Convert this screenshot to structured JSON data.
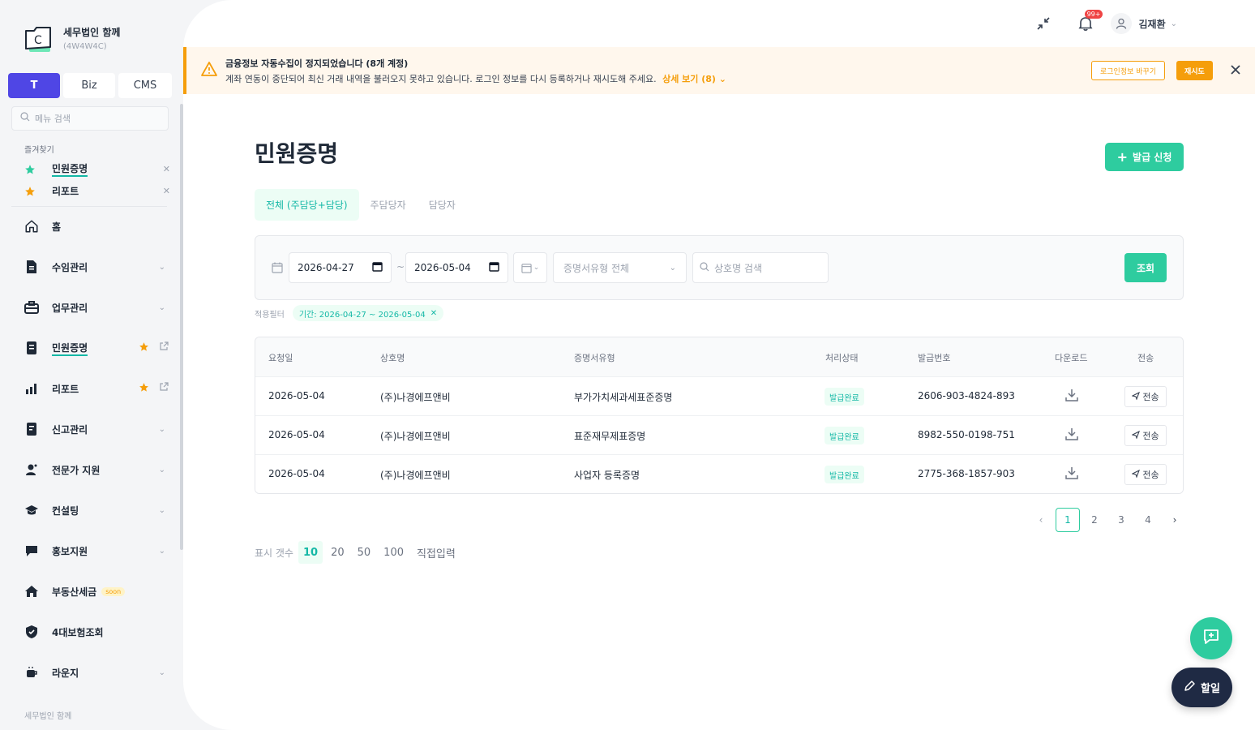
{
  "brand": {
    "name": "세무법인 함께",
    "code": "(4W4W4C)"
  },
  "mode_tabs": [
    {
      "label": "T"
    },
    {
      "label": "Biz"
    },
    {
      "label": "CMS"
    }
  ],
  "menu_search": {
    "placeholder": "메뉴 검색"
  },
  "favorites": {
    "title": "즐겨찾기",
    "items": [
      {
        "label": "민원증명"
      },
      {
        "label": "리포트"
      }
    ]
  },
  "nav": [
    {
      "label": "홈",
      "icon": "home-icon"
    },
    {
      "label": "수임관리",
      "icon": "document-icon"
    },
    {
      "label": "업무관리",
      "icon": "briefcase-icon"
    },
    {
      "label": "민원증명",
      "icon": "certificate-icon"
    },
    {
      "label": "리포트",
      "icon": "bar-chart-icon"
    },
    {
      "label": "신고관리",
      "icon": "report-icon"
    },
    {
      "label": "전문가 지원",
      "icon": "expert-icon"
    },
    {
      "label": "컨설팅",
      "icon": "graduation-cap-icon"
    },
    {
      "label": "홍보지원",
      "icon": "chat-icon"
    },
    {
      "label": "부동산세금",
      "icon": "house-icon",
      "badge": "soon"
    },
    {
      "label": "4대보험조회",
      "icon": "shield-icon"
    },
    {
      "label": "라운지",
      "icon": "coffee-icon"
    }
  ],
  "sidebar_footer": "세무법인 함께",
  "topbar": {
    "notification_badge": "99+",
    "user_name": "김재환"
  },
  "alert": {
    "title": "금융정보 자동수집이 정지되었습니다 (8개 계정)",
    "message": "계좌 연동이 중단되어 최신 거래 내역을 불러오지 못하고 있습니다. 로그인 정보를 다시 등록하거나 재시도해 주세요.",
    "detail_link": "상세 보기 (8)",
    "relogin_button": "로그인정보 바꾸기",
    "retry_button": "재시도"
  },
  "page": {
    "title": "민원증명",
    "issue_button": "발급 신청"
  },
  "tabs": [
    {
      "label": "전체 (주담당+담당)"
    },
    {
      "label": "주담당자"
    },
    {
      "label": "담당자"
    }
  ],
  "filters": {
    "date_from": "2026-04-27",
    "date_to": "2026-05-04",
    "dash": "~",
    "type_placeholder": "증명서유형 전체",
    "name_placeholder": "상호명 검색",
    "query_button": "조회",
    "applied_label": "적용필터",
    "applied_chip": "기간: 2026-04-27 ~ 2026-05-04"
  },
  "table": {
    "headers": [
      "요청일",
      "상호명",
      "증명서유형",
      "처리상태",
      "발급번호",
      "다운로드",
      "전송"
    ],
    "rows": [
      {
        "date": "2026-05-04",
        "company": "(주)나경에프앤비",
        "type": "부가가치세과세표준증명",
        "status": "발급완료",
        "number": "2606-903-4824-893",
        "send": "전송"
      },
      {
        "date": "2026-05-04",
        "company": "(주)나경에프앤비",
        "type": "표준재무제표증명",
        "status": "발급완료",
        "number": "8982-550-0198-751",
        "send": "전송"
      },
      {
        "date": "2026-05-04",
        "company": "(주)나경에프앤비",
        "type": "사업자 등록증명",
        "status": "발급완료",
        "number": "2775-368-1857-903",
        "send": "전송"
      }
    ]
  },
  "pagination": {
    "pages": [
      "1",
      "2",
      "3",
      "4"
    ],
    "current": "1"
  },
  "page_size": {
    "label": "표시 갯수",
    "options": [
      "10",
      "20",
      "50",
      "100",
      "직접입력"
    ],
    "selected": "10"
  },
  "fab": {
    "todo_label": "할일"
  },
  "colors": {
    "accent": "#2ecc9f",
    "primary": "#4f46e5",
    "warning": "#f59e0b",
    "dark": "#1f2a44"
  }
}
